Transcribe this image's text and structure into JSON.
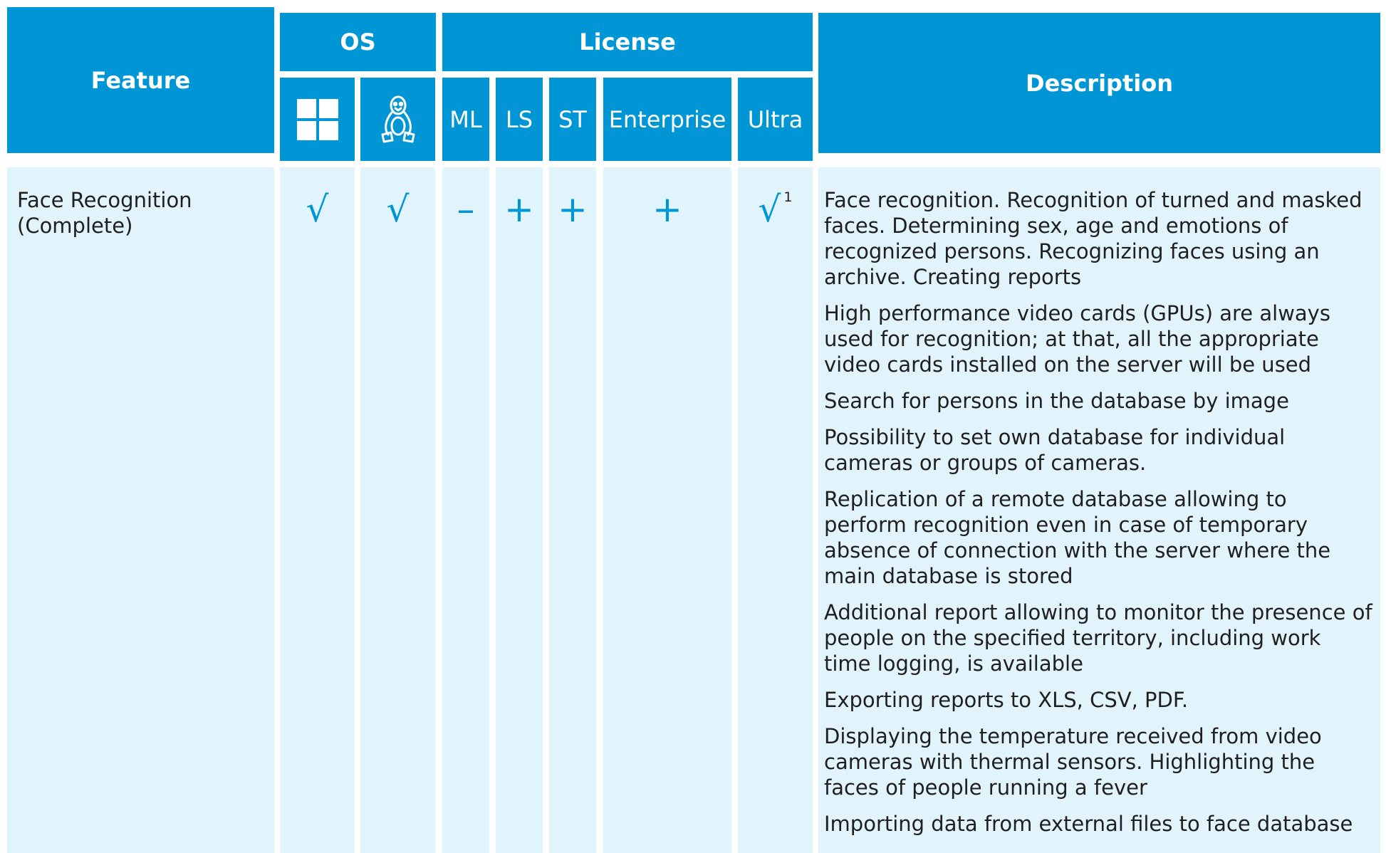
{
  "headers": {
    "feature": "Feature",
    "os": "OS",
    "license": "License",
    "description": "Description",
    "os_icons": [
      "windows-icon",
      "linux-icon"
    ],
    "licenses": [
      "ML",
      "LS",
      "ST",
      "Enterprise",
      "Ultra"
    ]
  },
  "row": {
    "feature": "Face Recognition\n(Complete)",
    "windows": "√",
    "linux": "√",
    "ml": "–",
    "ls": "+",
    "st": "+",
    "enterprise": "+",
    "ultra": "√",
    "ultra_footnote": "1",
    "description": [
      "Face recognition. Recognition of turned and masked faces. Determining sex, age and emotions of recognized persons. Recognizing faces using an archive. Creating reports",
      "High performance video cards (GPUs) are always used for recognition; at that, all the appropriate video cards installed on the server will be used",
      "Search for persons in the database by image",
      "Possibility to set own database for individual cameras or groups of cameras.",
      "Replication of a remote database allowing to perform recognition even in case of temporary absence of connection with the server where the main database is stored",
      "Additional report allowing to monitor the presence of people on the specified territory, including work time logging, is available",
      "Exporting reports to XLS, CSV, PDF.",
      "Displaying the temperature received from video cameras with thermal sensors. Highlighting the faces of people running a fever",
      "Importing data from external files to face database"
    ]
  },
  "colors": {
    "header": "#0096d6",
    "row": "#e1f4fc",
    "mark": "#0096d6",
    "text": "#1f1f1f"
  }
}
